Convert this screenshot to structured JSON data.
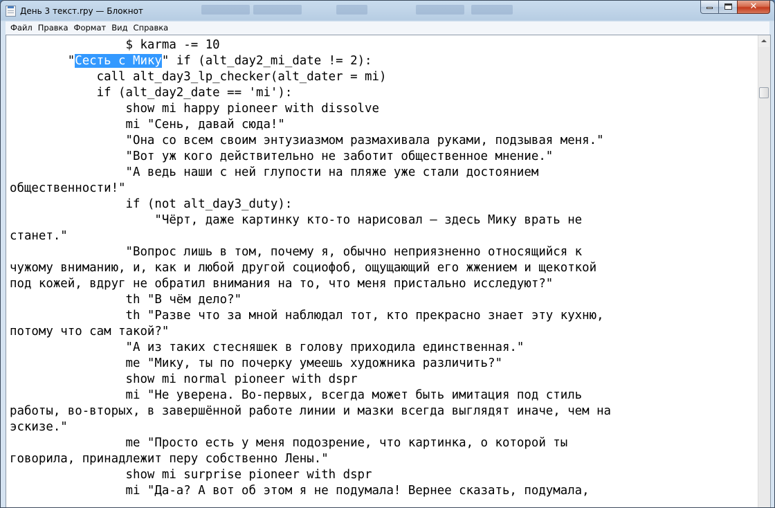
{
  "window": {
    "title": "День 3 текст.rpy — Блокнот",
    "controls": {
      "minimize": "minimize",
      "maximize": "maximize",
      "close": "✕"
    }
  },
  "menu": {
    "items": [
      "Файл",
      "Правка",
      "Формат",
      "Вид",
      "Справка"
    ]
  },
  "editor": {
    "lines": [
      {
        "before": "                $ karma -= 10",
        "selected": "",
        "after": ""
      },
      {
        "before": "        \"",
        "selected": "Сесть с Мику",
        "after": "\" if (alt_day2_mi_date != 2):"
      },
      {
        "before": "            call alt_day3_lp_checker(alt_dater = mi)",
        "selected": "",
        "after": ""
      },
      {
        "before": "            if (alt_day2_date == 'mi'):",
        "selected": "",
        "after": ""
      },
      {
        "before": "                show mi happy pioneer with dissolve",
        "selected": "",
        "after": ""
      },
      {
        "before": "                mi \"Сень, давай сюда!\"",
        "selected": "",
        "after": ""
      },
      {
        "before": "                \"Она со всем своим энтузиазмом размахивала руками, подзывая меня.\"",
        "selected": "",
        "after": ""
      },
      {
        "before": "                \"Вот уж кого действительно не заботит общественное мнение.\"",
        "selected": "",
        "after": ""
      },
      {
        "before": "                \"А ведь наши с ней глупости на пляже уже стали достоянием",
        "selected": "",
        "after": ""
      },
      {
        "before": "общественности!\"",
        "selected": "",
        "after": ""
      },
      {
        "before": "                if (not alt_day3_duty):",
        "selected": "",
        "after": ""
      },
      {
        "before": "                    \"Чёрт, даже картинку кто-то нарисовал — здесь Мику врать не",
        "selected": "",
        "after": ""
      },
      {
        "before": "станет.\"",
        "selected": "",
        "after": ""
      },
      {
        "before": "                \"Вопрос лишь в том, почему я, обычно неприязненно относящийся к",
        "selected": "",
        "after": ""
      },
      {
        "before": "чужому вниманию, и, как и любой другой социофоб, ощущающий его жжением и щекоткой",
        "selected": "",
        "after": ""
      },
      {
        "before": "под кожей, вдруг не обратил внимания на то, что меня пристально исследуют?\"",
        "selected": "",
        "after": ""
      },
      {
        "before": "                th \"В чём дело?\"",
        "selected": "",
        "after": ""
      },
      {
        "before": "                th \"Разве что за мной наблюдал тот, кто прекрасно знает эту кухню,",
        "selected": "",
        "after": ""
      },
      {
        "before": "потому что сам такой?\"",
        "selected": "",
        "after": ""
      },
      {
        "before": "                \"А из таких стесняшек в голову приходила единственная.\"",
        "selected": "",
        "after": ""
      },
      {
        "before": "                me \"Мику, ты по почерку умеешь художника различить?\"",
        "selected": "",
        "after": ""
      },
      {
        "before": "                show mi normal pioneer with dspr",
        "selected": "",
        "after": ""
      },
      {
        "before": "                mi \"Не уверена. Во-первых, всегда может быть имитация под стиль",
        "selected": "",
        "after": ""
      },
      {
        "before": "работы, во-вторых, в завершённой работе линии и мазки всегда выглядят иначе, чем на",
        "selected": "",
        "after": ""
      },
      {
        "before": "эскизе.\"",
        "selected": "",
        "after": ""
      },
      {
        "before": "                me \"Просто есть у меня подозрение, что картинка, о которой ты",
        "selected": "",
        "after": ""
      },
      {
        "before": "говорила, принадлежит перу собственно Лены.\"",
        "selected": "",
        "after": ""
      },
      {
        "before": "                show mi surprise pioneer with dspr",
        "selected": "",
        "after": ""
      },
      {
        "before": "                mi \"Да-а? А вот об этом я не подумала! Вернее сказать, подумала,",
        "selected": "",
        "after": ""
      }
    ]
  },
  "colors": {
    "selection": "#3399ff",
    "close_button": "#c43b1e"
  }
}
